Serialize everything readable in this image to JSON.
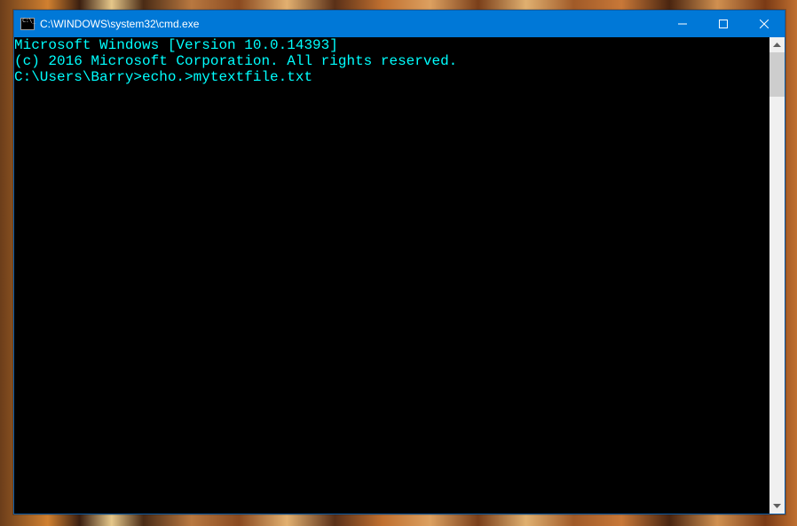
{
  "window": {
    "title": "C:\\WINDOWS\\system32\\cmd.exe"
  },
  "terminal": {
    "line1": "Microsoft Windows [Version 10.0.14393]",
    "line2": "(c) 2016 Microsoft Corporation. All rights reserved.",
    "blank": "",
    "prompt_line": "C:\\Users\\Barry>echo.>mytextfile.txt"
  }
}
